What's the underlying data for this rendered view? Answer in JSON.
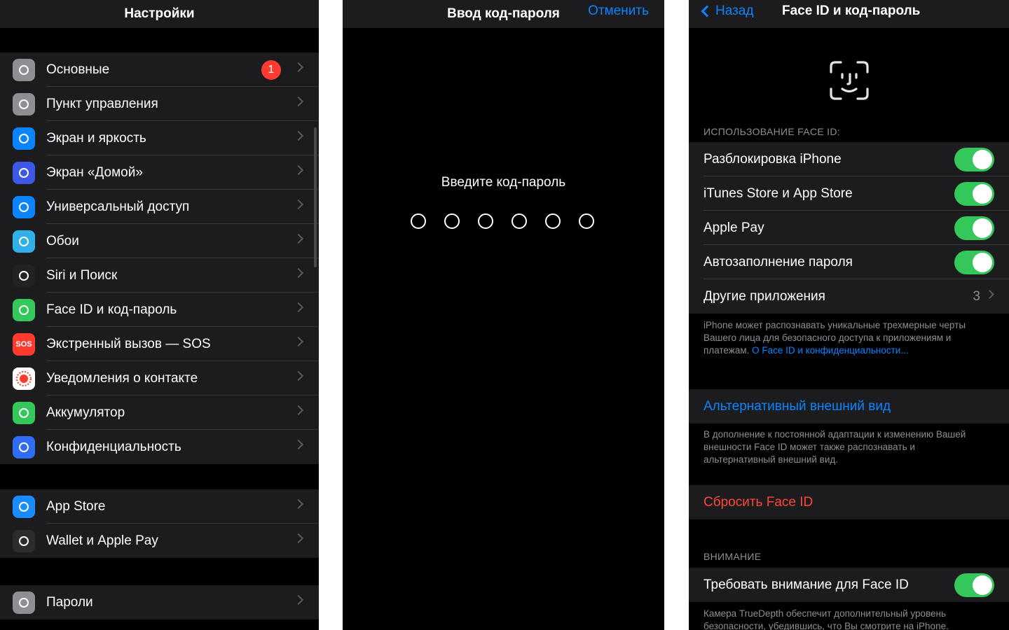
{
  "settings": {
    "title": "Настройки",
    "badge": "1",
    "group1": [
      {
        "label": "Основные",
        "icon": "gear-icon",
        "color": "#8e8e93"
      },
      {
        "label": "Пункт управления",
        "icon": "control-center-icon",
        "color": "#8e8e93"
      },
      {
        "label": "Экран и яркость",
        "icon": "display-icon",
        "color": "#0a84ff"
      },
      {
        "label": "Экран «Домой»",
        "icon": "home-screen-icon",
        "color": "#3d58e6"
      },
      {
        "label": "Универсальный доступ",
        "icon": "accessibility-icon",
        "color": "#0a84ff"
      },
      {
        "label": "Обои",
        "icon": "wallpaper-icon",
        "color": "#30b0e8"
      },
      {
        "label": "Siri и Поиск",
        "icon": "siri-icon",
        "color": "#222"
      },
      {
        "label": "Face ID и код-пароль",
        "icon": "faceid-icon",
        "color": "#34c759"
      },
      {
        "label": "Экстренный вызов — SOS",
        "icon": "sos-icon",
        "color": "#ff3b30",
        "glyph": "SOS"
      },
      {
        "label": "Уведомления о контакте",
        "icon": "exposure-icon",
        "color": "#ffffff"
      },
      {
        "label": "Аккумулятор",
        "icon": "battery-icon",
        "color": "#34c759"
      },
      {
        "label": "Конфиденциальность",
        "icon": "hand-icon",
        "color": "#2f6df6"
      }
    ],
    "group2": [
      {
        "label": "App Store",
        "icon": "app-store-icon",
        "color": "#1a8cff"
      },
      {
        "label": "Wallet и Apple Pay",
        "icon": "wallet-icon",
        "color": "#2c2c2e"
      }
    ],
    "group3": [
      {
        "label": "Пароли",
        "icon": "key-icon",
        "color": "#8e8e93"
      }
    ]
  },
  "passcode": {
    "title": "Ввод код-пароля",
    "cancel": "Отменить",
    "prompt": "Введите код-пароль",
    "dot_count": 6
  },
  "faceid": {
    "back": "Назад",
    "title": "Face ID и код-пароль",
    "use_header": "ИСПОЛЬЗОВАНИЕ FACE ID:",
    "toggles": [
      {
        "label": "Разблокировка iPhone",
        "on": true
      },
      {
        "label": "iTunes Store и App Store",
        "on": true
      },
      {
        "label": "Apple Pay",
        "on": true
      },
      {
        "label": "Автозаполнение пароля",
        "on": true
      }
    ],
    "other_apps_label": "Другие приложения",
    "other_apps_count": "3",
    "footnote1": "iPhone может распознавать уникальные трехмерные черты Вашего лица для безопасного доступа к приложениям и платежам.",
    "footnote1_link": "О Face ID и конфиденциальности...",
    "alt_appearance": "Альтернативный внешний вид",
    "footnote2": "В дополнение к постоянной адаптации к изменению Вашей внешности Face ID может также распознавать и альтернативный внешний вид.",
    "reset": "Сбросить Face ID",
    "attention_header": "ВНИМАНИЕ",
    "attention_toggle": "Требовать внимание для Face ID",
    "footnote3": "Камера TrueDepth обеспечит дополнительный уровень безопасности, убедившись, что Вы смотрите на iPhone."
  }
}
